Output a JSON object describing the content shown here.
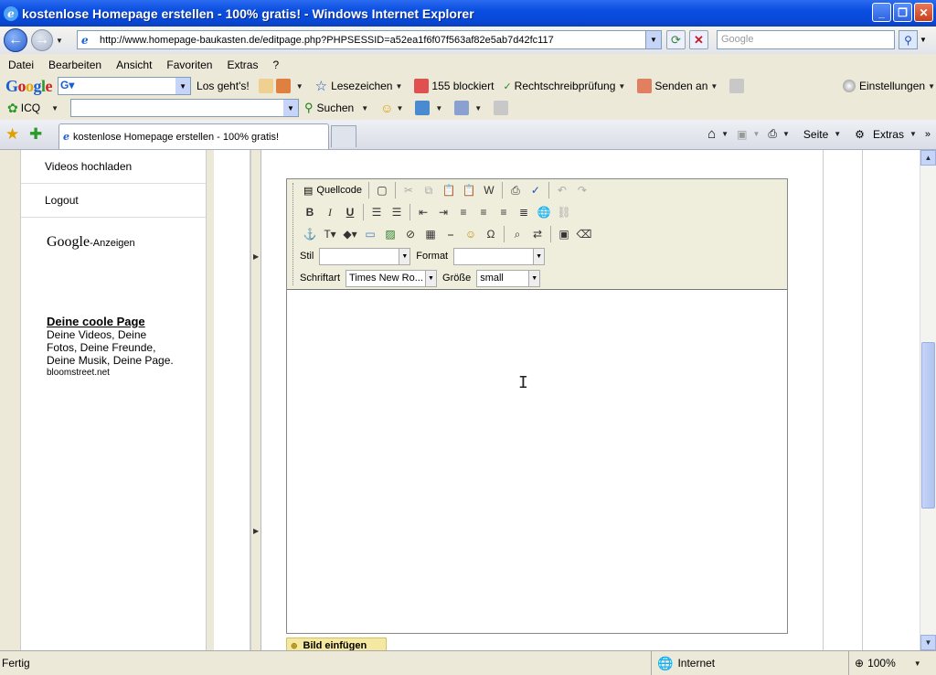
{
  "window": {
    "title": "kostenlose Homepage erstellen - 100% gratis! - Windows Internet Explorer"
  },
  "address": {
    "url": "http://www.homepage-baukasten.de/editpage.php?PHPSESSID=a52ea1f6f07f563af82e5ab7d42fc117"
  },
  "search": {
    "placeholder": "Google"
  },
  "menu": [
    "Datei",
    "Bearbeiten",
    "Ansicht",
    "Favoriten",
    "Extras",
    "?"
  ],
  "google_toolbar": {
    "logo": "Google",
    "go": "Los geht's!",
    "bookmarks": "Lesezeichen",
    "blocked": "155 blockiert",
    "spellcheck": "Rechtschreibprüfung",
    "send": "Senden an",
    "settings": "Einstellungen"
  },
  "icq_toolbar": {
    "label": "ICQ",
    "search": "Suchen"
  },
  "tab": {
    "title": "kostenlose Homepage erstellen - 100% gratis!"
  },
  "cmdbar": {
    "page": "Seite",
    "tools": "Extras"
  },
  "sidebar": {
    "items": [
      {
        "label": "Videos hochladen"
      },
      {
        "label": "Logout"
      }
    ],
    "ads_google": "Google",
    "ads_label": "-Anzeigen"
  },
  "ad": {
    "headline": "Deine coole Page",
    "body": "Deine Videos, Deine Fotos, Deine Freunde, Deine Musik, Deine Page.",
    "url": "bloomstreet.net"
  },
  "editor": {
    "source": "Quellcode",
    "style_label": "Stil",
    "format_label": "Format",
    "font_label": "Schriftart",
    "font_value": "Times New Ro...",
    "size_label": "Größe",
    "size_value": "small"
  },
  "image_button": "Bild einfügen",
  "status": {
    "text": "Fertig",
    "zone": "Internet",
    "zoom": "100%"
  }
}
